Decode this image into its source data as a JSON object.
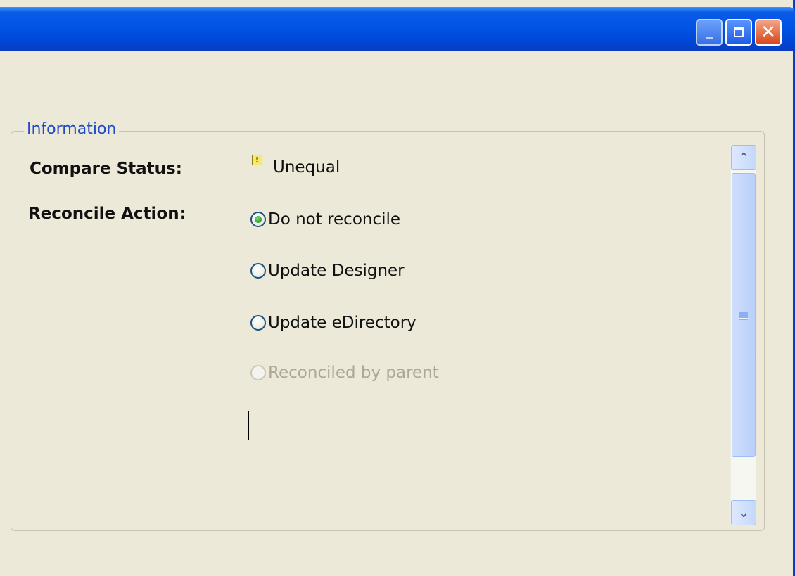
{
  "group": {
    "title": "Information"
  },
  "compare_status": {
    "label": "Compare Status:",
    "value": "Unequal",
    "icon": "warning-icon"
  },
  "reconcile_action": {
    "label": "Reconcile Action:",
    "options": [
      {
        "label": "Do not reconcile",
        "checked": true,
        "enabled": true
      },
      {
        "label": "Update Designer",
        "checked": false,
        "enabled": true
      },
      {
        "label": "Update eDirectory",
        "checked": false,
        "enabled": true
      },
      {
        "label": "Reconciled by parent",
        "checked": false,
        "enabled": false
      }
    ]
  },
  "colors": {
    "titlebar": "#0055e5",
    "group_title": "#1f4ac8",
    "radio_checked": "#2fa82f",
    "disabled_text": "#aca899"
  }
}
